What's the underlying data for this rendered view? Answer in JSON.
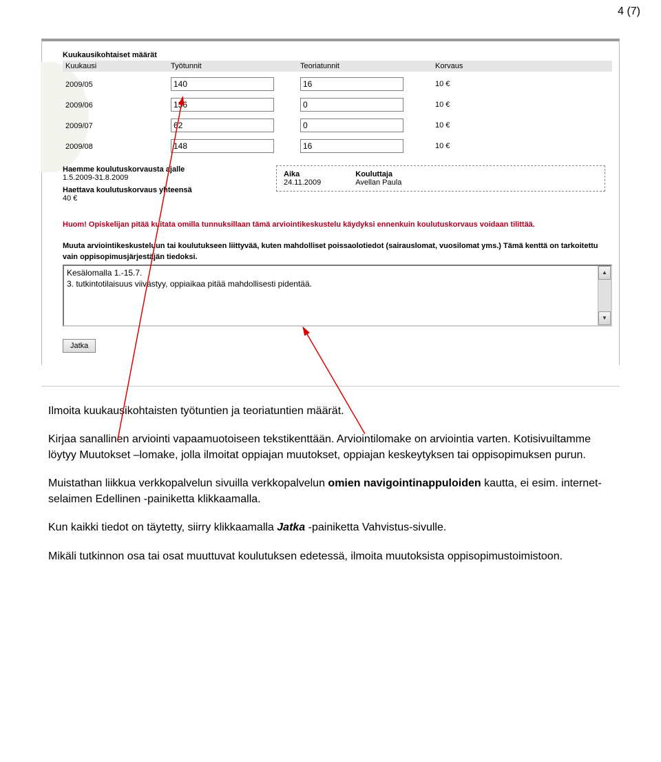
{
  "page_number": "4 (7)",
  "form": {
    "amount_title": "Kuukausikohtaiset määrät",
    "headers": {
      "kuukausi": "Kuukausi",
      "tyotunnit": "Työtunnit",
      "teoriatunnit": "Teoriatunnit",
      "korvaus": "Korvaus"
    },
    "rows": [
      {
        "kk": "2009/05",
        "ty": "140",
        "te": "16",
        "kv": "10 €"
      },
      {
        "kk": "2009/06",
        "ty": "136",
        "te": "0",
        "kv": "10 €"
      },
      {
        "kk": "2009/07",
        "ty": "62",
        "te": "0",
        "kv": "10 €"
      },
      {
        "kk": "2009/08",
        "ty": "148",
        "te": "16",
        "kv": "10 €"
      }
    ],
    "apply_label": "Haemme koulutuskorvausta ajalle",
    "apply_range": "1.5.2009-31.8.2009",
    "total_label": "Haettava koulutuskorvaus yhteensä",
    "total_value": "40 €",
    "aika_label": "Aika",
    "aika_value": "24.11.2009",
    "kouluttaja_label": "Kouluttaja",
    "kouluttaja_value": "Avellan Paula",
    "red_notice": "Huom! Opiskelijan pitää kuitata omilla tunnuksillaan tämä arviointikeskustelu käydyksi ennenkuin koulutuskorvaus voidaan tilittää.",
    "other_info_label": "Muuta arviointikeskusteluun tai koulutukseen liittyvää, kuten mahdolliset poissaolotiedot (sairauslomat, vuosilomat yms.) Tämä kenttä on tarkoitettu vain oppisopimusjärjestäjän tiedoksi.",
    "textarea_value": "Kesälomalla 1.-15.7.\n3. tutkintotilaisuus viivästyy, oppiaikaa pitää mahdollisesti pidentää.",
    "jatka_label": "Jatka"
  },
  "doc": {
    "p1": "Ilmoita kuukausikohtaisten työtuntien ja teoriatuntien määrät.",
    "p2a": "Kirjaa sanallinen arviointi vapaamuotoiseen tekstikenttään. Arviointilomake on arviointia varten. Kotisivuiltamme löytyy Muutokset –lomake, jolla ilmoitat oppiajan muutokset, oppiajan keskeytyksen tai oppisopimuksen purun.",
    "p3a": "Muistathan liikkua verkkopalvelun sivuilla verkkopalvelun ",
    "p3b_bold": "omien navigointinappuloiden",
    "p3c": " kautta, ei esim. internet-selaimen Edellinen -painiketta klikkaamalla.",
    "p4a": "Kun kaikki tiedot on täytetty, siirry klikkaamalla ",
    "p4b_bolditalic": "Jatka",
    "p4c": " -painiketta Vahvistus-sivulle.",
    "p5": "Mikäli tutkinnon osa tai osat muuttuvat koulutuksen edetessä, ilmoita muutoksista oppisopimustoimistoon."
  }
}
